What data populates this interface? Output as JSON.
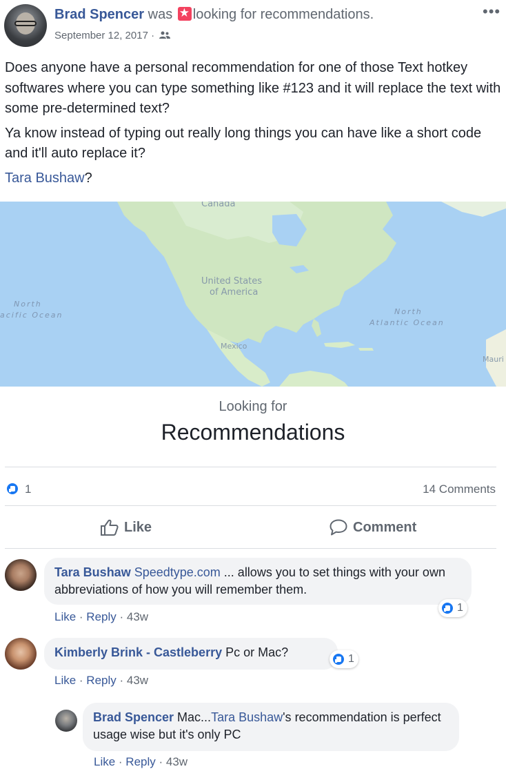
{
  "post": {
    "author": "Brad Spencer",
    "was_text": "was",
    "activity": "looking for recommendations.",
    "date": "September 12, 2017",
    "separator": "·",
    "more_label": "•••",
    "paragraphs": [
      "Does anyone have a personal recommendation for one of those Text hotkey softwares where you can type something like #123 and it will replace the text with some pre-determined text?",
      "Ya know instead of typing out really long things you can have like a short code and it'll auto replace it?"
    ],
    "mention": "Tara Bushaw",
    "mention_suffix": "?"
  },
  "map": {
    "labels": {
      "canada": "Canada",
      "usa_line1": "United States",
      "usa_line2": "of America",
      "mexico": "Mexico",
      "npac_line1": "North",
      "npac_line2": "acific Ocean",
      "natl_line1": "North",
      "natl_line2": "Atlantic Ocean",
      "mauri": "Mauri"
    }
  },
  "card": {
    "subtitle": "Looking for",
    "title": "Recommendations"
  },
  "stats": {
    "reactions": "1",
    "comments": "14 Comments"
  },
  "actions": {
    "like": "Like",
    "comment": "Comment"
  },
  "comments": [
    {
      "name": "Tara Bushaw",
      "link": "Speedtype.com",
      "text": " ... allows you to set things with your own abbreviations of how you will remember them.",
      "like": "Like",
      "reply": "Reply",
      "sep": " · ",
      "time": "43w",
      "reactions": "1"
    },
    {
      "name": "Kimberly Brink - Castleberry",
      "text": " Pc or Mac?",
      "like": "Like",
      "reply": "Reply",
      "sep": " · ",
      "time": "43w",
      "reactions": "1"
    },
    {
      "name": "Brad Spencer",
      "text_before": " Mac...",
      "mention": "Tara Bushaw",
      "text_after": "'s recommendation is perfect usage wise but it's only PC",
      "like": "Like",
      "reply": "Reply",
      "sep": " · ",
      "time": "43w"
    }
  ]
}
